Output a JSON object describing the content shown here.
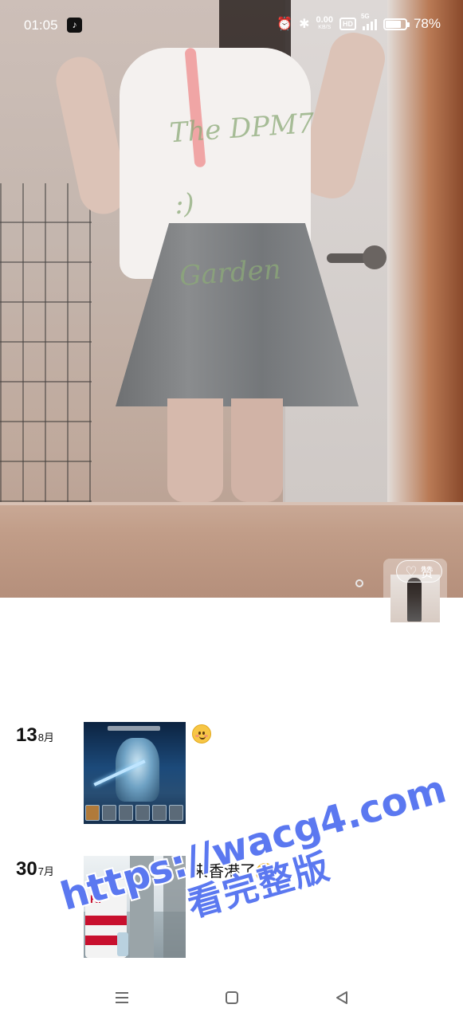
{
  "status_bar": {
    "time": "01:05",
    "net_speed_value": "0.00",
    "net_speed_unit": "KB/S",
    "hd_label": "HD",
    "network_type": "5G",
    "battery_percent": "78%",
    "battery_level": 0.78,
    "app_notification_icon": "tiktok-icon",
    "alarm_icon": "alarm-icon",
    "bluetooth_icon": "bluetooth-icon"
  },
  "hero": {
    "handwriting_line1": "The DPM7 :)",
    "handwriting_line2": "Garden",
    "page_indicator_icon": "dot-indicator"
  },
  "like_widget": {
    "label": "赞",
    "icon": "heart-outline-icon"
  },
  "feed": [
    {
      "day": "13",
      "month": "8月",
      "caption": "",
      "emoji": "blushing-smile-emoji",
      "thumbnail": "game-hero-screenshot"
    },
    {
      "day": "30",
      "month": "7月",
      "caption": "来香港了",
      "emoji": "grinning-emoji",
      "thumbnail": "ferry-window-photo"
    }
  ],
  "watermark": {
    "url": "https://wacg4.com",
    "subtitle": "看完整版"
  },
  "nav_bar": {
    "menu_icon": "menu-icon",
    "home_icon": "home-icon",
    "back_icon": "back-icon"
  },
  "colors": {
    "watermark": "#5b78f0",
    "text_primary": "#111111",
    "background": "#ffffff"
  }
}
